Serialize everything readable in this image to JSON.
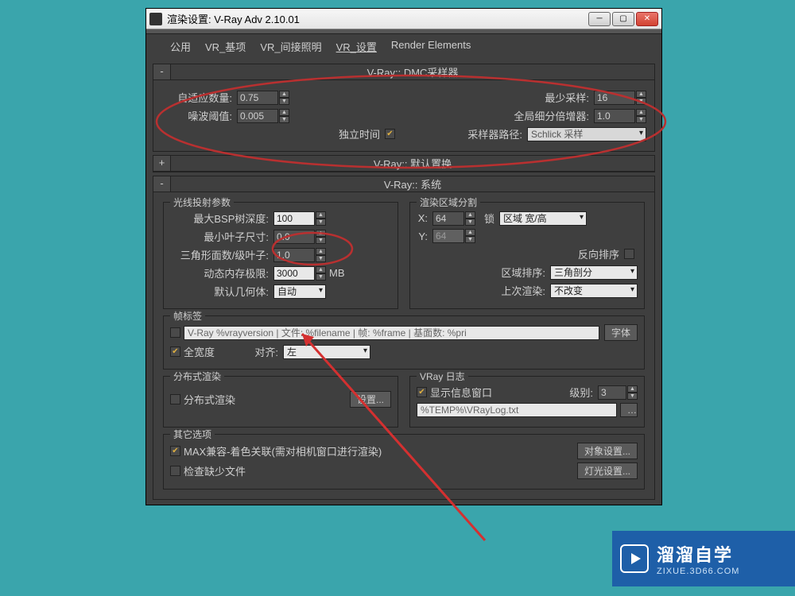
{
  "window": {
    "title": "渲染设置: V-Ray Adv 2.10.01"
  },
  "tabs": [
    "公用",
    "VR_基项",
    "VR_间接照明",
    "VR_设置",
    "Render Elements"
  ],
  "rollout_dmc": {
    "title": "V-Ray:: DMC采样器",
    "adaptive_amount_lbl": "自适应数量:",
    "adaptive_amount": "0.75",
    "noise_thresh_lbl": "噪波阈值:",
    "noise_thresh": "0.005",
    "independent_time_lbl": "独立时间",
    "min_samples_lbl": "最少采样:",
    "min_samples": "16",
    "global_mult_lbl": "全局细分倍增器:",
    "global_mult": "1.0",
    "sampler_path_lbl": "采样器路径:",
    "sampler_path": "Schlick 采样"
  },
  "rollout_displace": {
    "title": "V-Ray:: 默认置换"
  },
  "rollout_system": {
    "title": "V-Ray:: 系统",
    "raycast_group": "光线投射参数",
    "max_bsp_lbl": "最大BSP树深度:",
    "max_bsp": "100",
    "min_leaf_lbl": "最小叶子尺寸:",
    "min_leaf": "0.0",
    "face_leaf_lbl": "三角形面数/级叶子:",
    "face_leaf": "1.0",
    "dyn_mem_lbl": "动态内存极限:",
    "dyn_mem": "3000",
    "dyn_mem_unit": "MB",
    "default_geom_lbl": "默认几何体:",
    "default_geom": "自动",
    "region_group": "渲染区域分割",
    "x_lbl": "X:",
    "x_val": "64",
    "y_lbl": "Y:",
    "y_val": "64",
    "lock_lbl": "锁",
    "region_wh": "区域 宽/高",
    "reverse_lbl": "反向排序",
    "region_order_lbl": "区域排序:",
    "region_order": "三角剖分",
    "last_render_lbl": "上次渲染:",
    "last_render": "不改变",
    "frame_group": "帧标签",
    "stamp_text": "V-Ray %vrayversion | 文件: %filename | 帧: %frame | 基面数: %pri",
    "font_btn": "字体",
    "full_width_lbl": "全宽度",
    "justify_lbl": "对齐:",
    "justify": "左",
    "dist_group": "分布式渲染",
    "dist_chk_lbl": "分布式渲染",
    "dist_btn": "设置...",
    "log_group": "VRay 日志",
    "show_window_lbl": "显示信息窗口",
    "level_lbl": "级别:",
    "level_val": "3",
    "log_path": "%TEMP%\\VRayLog.txt",
    "other_group": "其它选项",
    "max_compat_lbl": "MAX兼容-着色关联(需对相机窗口进行渲染)",
    "obj_settings_btn": "对象设置...",
    "missing_files_lbl": "检查缺少文件",
    "light_settings_btn": "灯光设置..."
  },
  "banner": {
    "title": "溜溜自学",
    "url": "ZIXUE.3D66.COM"
  }
}
